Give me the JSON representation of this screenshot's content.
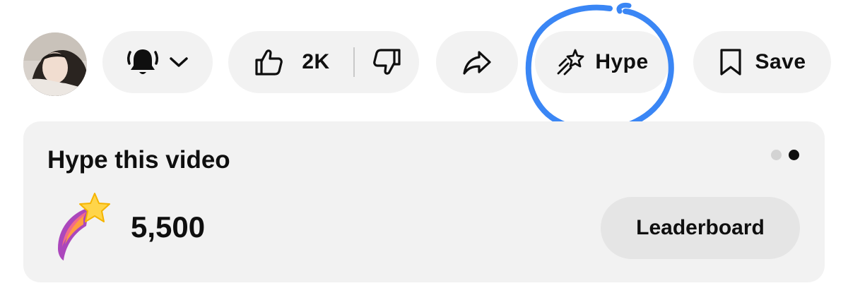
{
  "actions": {
    "like_count": "2K",
    "hype_label": "Hype",
    "save_label": "Save"
  },
  "hype_card": {
    "title": "Hype this video",
    "points": "5,500",
    "leaderboard_label": "Leaderboard",
    "page_dots": {
      "count": 2,
      "active_index": 1
    }
  },
  "icons": [
    "bell-icon",
    "chevron-down-icon",
    "thumbs-up-icon",
    "thumbs-down-icon",
    "share-arrow-icon",
    "hype-star-icon",
    "bookmark-icon",
    "shooting-star-icon"
  ],
  "colors": {
    "pill_background": "#f2f2f2",
    "card_background": "#f2f2f2",
    "leaderboard_background": "#e5e5e5",
    "annotation_scribble": "#3a86f5",
    "dot_active": "#0f0f0f",
    "dot_inactive": "#d3d3d3"
  }
}
